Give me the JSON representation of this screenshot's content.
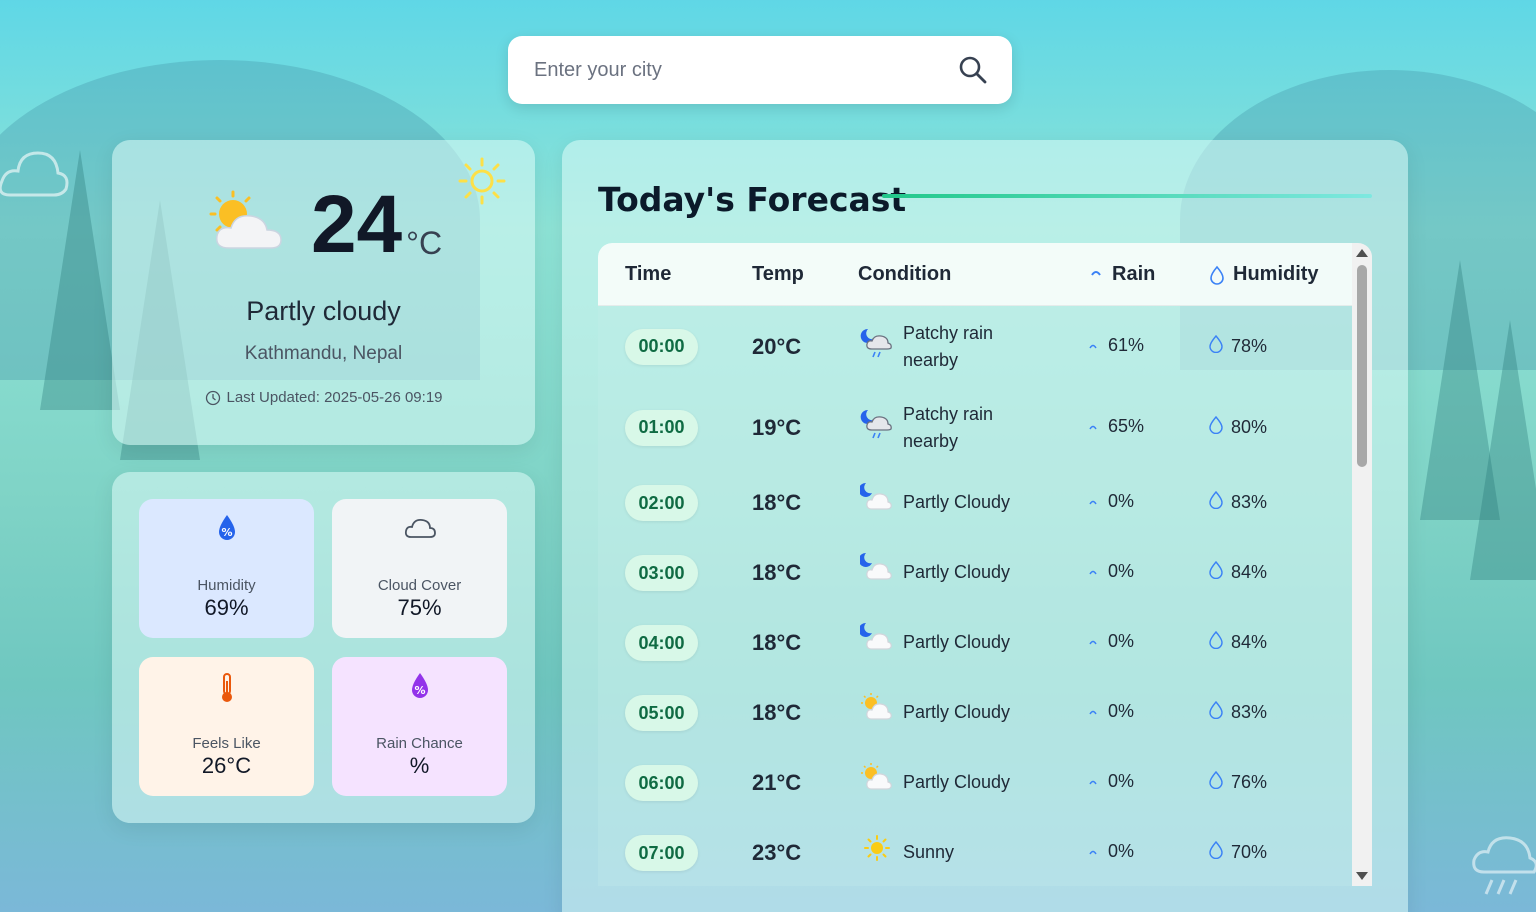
{
  "search": {
    "placeholder": "Enter your city"
  },
  "current": {
    "temp": "24",
    "unit": "°C",
    "condition": "Partly cloudy",
    "location": "Kathmandu, Nepal",
    "updated": "Last Updated: 2025-05-26 09:19"
  },
  "stats": [
    {
      "label": "Humidity",
      "value": "69%",
      "icon": "humidity-drop-icon",
      "bg": "#dbe8ff",
      "color": "#2563eb"
    },
    {
      "label": "Cloud Cover",
      "value": "75%",
      "icon": "cloud-icon",
      "bg": "#f1f4f6",
      "color": "#4b5563"
    },
    {
      "label": "Feels Like",
      "value": "26°C",
      "icon": "thermometer-icon",
      "bg": "#fff3e8",
      "color": "#ea580c"
    },
    {
      "label": "Rain Chance",
      "value": "%",
      "icon": "rain-drop-icon",
      "bg": "#f5e3ff",
      "color": "#9333ea"
    }
  ],
  "forecast": {
    "title": "Today's Forecast",
    "headers": {
      "time": "Time",
      "temp": "Temp",
      "condition": "Condition",
      "rain": "Rain",
      "humidity": "Humidity"
    },
    "rows": [
      {
        "time": "00:00",
        "temp": "20°C",
        "condition": "Patchy rain nearby",
        "icon": "night-rain-icon",
        "rain": "61%",
        "humidity": "78%"
      },
      {
        "time": "01:00",
        "temp": "19°C",
        "condition": "Patchy rain nearby",
        "icon": "night-rain-icon",
        "rain": "65%",
        "humidity": "80%"
      },
      {
        "time": "02:00",
        "temp": "18°C",
        "condition": "Partly Cloudy",
        "icon": "night-cloud-icon",
        "rain": "0%",
        "humidity": "83%"
      },
      {
        "time": "03:00",
        "temp": "18°C",
        "condition": "Partly Cloudy",
        "icon": "night-cloud-icon",
        "rain": "0%",
        "humidity": "84%"
      },
      {
        "time": "04:00",
        "temp": "18°C",
        "condition": "Partly Cloudy",
        "icon": "night-cloud-icon",
        "rain": "0%",
        "humidity": "84%"
      },
      {
        "time": "05:00",
        "temp": "18°C",
        "condition": "Partly Cloudy",
        "icon": "sun-cloud-icon",
        "rain": "0%",
        "humidity": "83%"
      },
      {
        "time": "06:00",
        "temp": "21°C",
        "condition": "Partly Cloudy",
        "icon": "sun-cloud-icon",
        "rain": "0%",
        "humidity": "76%"
      },
      {
        "time": "07:00",
        "temp": "23°C",
        "condition": "Sunny",
        "icon": "sun-icon",
        "rain": "0%",
        "humidity": "70%"
      }
    ]
  }
}
